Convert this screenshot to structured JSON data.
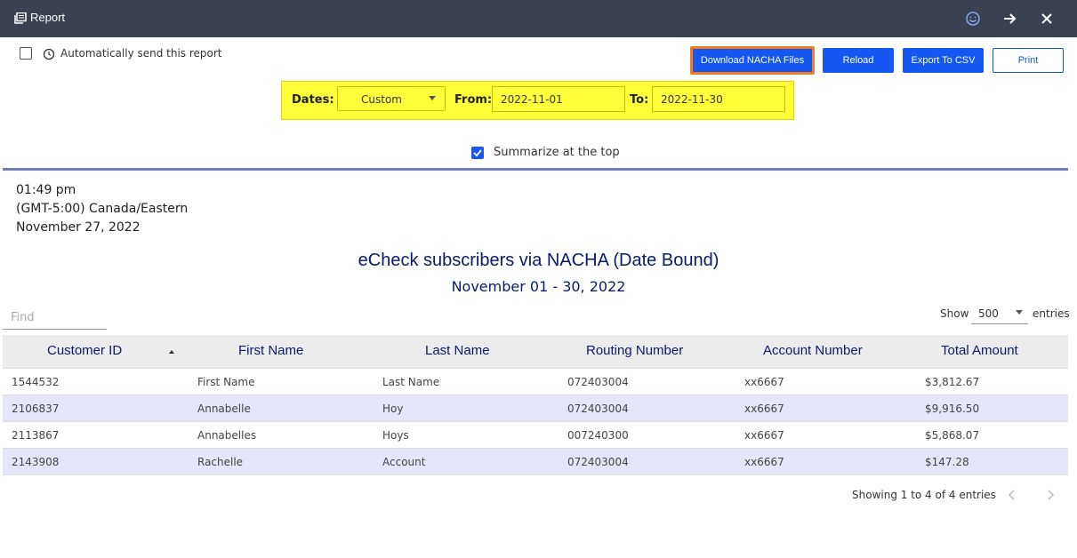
{
  "window": {
    "title": "Report",
    "icons": [
      "report-icon",
      "smiley-icon",
      "arrow-right-icon",
      "close-icon"
    ]
  },
  "controls": {
    "auto_send_label": "Automatically send this report",
    "auto_send_checked": false,
    "buttons": {
      "download_nacha": "Download NACHA Files",
      "reload": "Reload",
      "export_csv": "Export To CSV",
      "print": "Print"
    },
    "colors": {
      "primary": "#1557f0",
      "highlight_border": "#f47c20",
      "filter_bg": "#ffff3a"
    }
  },
  "date_filter": {
    "dates_label": "Dates:",
    "dates_value": "Custom",
    "from_label": "From:",
    "from_value": "2022-11-01",
    "to_label": "To:",
    "to_value": "2022-11-30"
  },
  "summarize": {
    "label": "Summarize at the top",
    "checked": true
  },
  "report": {
    "time": "01:49 pm",
    "timezone": "(GMT-5:00) Canada/Eastern",
    "date": "November 27, 2022",
    "title": "eCheck subscribers via NACHA (Date Bound)",
    "subtitle": "November 01 - 30, 2022"
  },
  "table_controls": {
    "find_placeholder": "Find",
    "show_label": "Show",
    "show_value": "500",
    "entries_label": "entries"
  },
  "table": {
    "columns": [
      "Customer ID",
      "First Name",
      "Last Name",
      "Routing Number",
      "Account Number",
      "Total Amount"
    ],
    "rows": [
      [
        "1544532",
        "First Name",
        "Last Name",
        "072403004",
        "xx6667",
        "$3,812.67"
      ],
      [
        "2106837",
        "Annabelle",
        "Hoy",
        "072403004",
        "xx6667",
        "$9,916.50"
      ],
      [
        "2113867",
        "Annabelles",
        "Hoys",
        "007240300",
        "xx6667",
        "$5,868.07"
      ],
      [
        "2143908",
        "Rachelle",
        "Account",
        "072403004",
        "xx6667",
        "$147.28"
      ]
    ],
    "footer": "Showing 1 to 4 of 4 entries"
  }
}
